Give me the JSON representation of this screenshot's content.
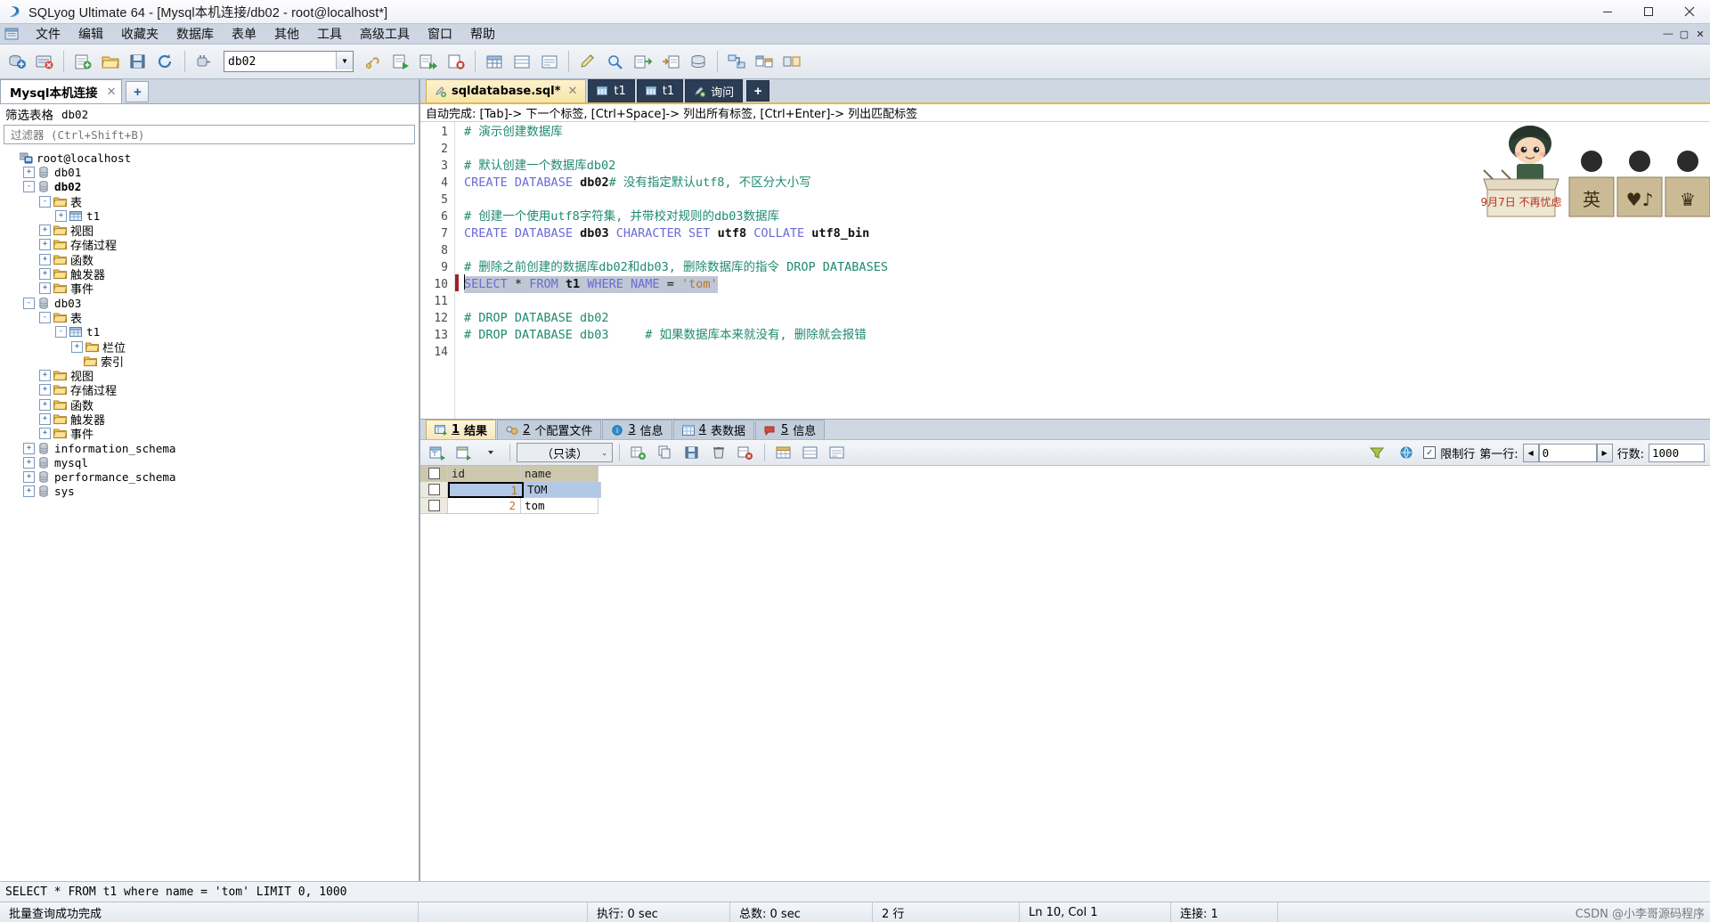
{
  "window": {
    "title": "SQLyog Ultimate 64 - [Mysql本机连接/db02 - root@localhost*]",
    "minimize": "—",
    "maximize": "▢",
    "close": "✕",
    "inner_minimize": "—",
    "inner_restore": "▢",
    "inner_close": "✕"
  },
  "menu": {
    "items": [
      {
        "label": "文件"
      },
      {
        "label": "编辑"
      },
      {
        "label": "收藏夹"
      },
      {
        "label": "数据库"
      },
      {
        "label": "表单"
      },
      {
        "label": "其他"
      },
      {
        "label": "工具"
      },
      {
        "label": "高级工具"
      },
      {
        "label": "窗口"
      },
      {
        "label": "帮助"
      }
    ]
  },
  "toolbar": {
    "db_selected": "db02",
    "buttons": [
      {
        "name": "new-connection-button"
      },
      {
        "name": "open-file-button"
      },
      {
        "name": "save-file-button"
      },
      {
        "name": "refresh-button"
      },
      {
        "name": "execute-query-button"
      },
      {
        "name": "stop-query-button"
      }
    ]
  },
  "sidebar": {
    "connection_tab": "Mysql本机连接",
    "connection_tab_close": "✕",
    "add_connection": "+",
    "filter_label": "筛选表格",
    "filter_db": "db02",
    "filter_placeholder": "过滤器 (Ctrl+Shift+B)",
    "filter_value": "",
    "tree": [
      {
        "label": "root@localhost",
        "level": 0,
        "expander": "",
        "icon": "server-icon",
        "bold": false,
        "cn": false
      },
      {
        "label": "db01",
        "level": 1,
        "expander": "+",
        "icon": "database-icon",
        "bold": false,
        "cn": false
      },
      {
        "label": "db02",
        "level": 1,
        "expander": "-",
        "icon": "database-icon",
        "bold": true,
        "cn": false
      },
      {
        "label": "表",
        "level": 2,
        "expander": "-",
        "icon": "folder-icon",
        "bold": false,
        "cn": true
      },
      {
        "label": "t1",
        "level": 3,
        "expander": "+",
        "icon": "table-icon",
        "bold": false,
        "cn": false
      },
      {
        "label": "视图",
        "level": 2,
        "expander": "+",
        "icon": "folder-icon",
        "bold": false,
        "cn": true
      },
      {
        "label": "存储过程",
        "level": 2,
        "expander": "+",
        "icon": "folder-icon",
        "bold": false,
        "cn": true
      },
      {
        "label": "函数",
        "level": 2,
        "expander": "+",
        "icon": "folder-icon",
        "bold": false,
        "cn": true
      },
      {
        "label": "触发器",
        "level": 2,
        "expander": "+",
        "icon": "folder-icon",
        "bold": false,
        "cn": true
      },
      {
        "label": "事件",
        "level": 2,
        "expander": "+",
        "icon": "folder-icon",
        "bold": false,
        "cn": true
      },
      {
        "label": "db03",
        "level": 1,
        "expander": "-",
        "icon": "database-icon",
        "bold": false,
        "cn": false
      },
      {
        "label": "表",
        "level": 2,
        "expander": "-",
        "icon": "folder-icon",
        "bold": false,
        "cn": true
      },
      {
        "label": "t1",
        "level": 3,
        "expander": "-",
        "icon": "table-icon",
        "bold": false,
        "cn": false
      },
      {
        "label": "栏位",
        "level": 4,
        "expander": "+",
        "icon": "folder-icon",
        "bold": false,
        "cn": true
      },
      {
        "label": "索引",
        "level": 4,
        "expander": "",
        "icon": "folder-icon",
        "bold": false,
        "cn": true
      },
      {
        "label": "视图",
        "level": 2,
        "expander": "+",
        "icon": "folder-icon",
        "bold": false,
        "cn": true
      },
      {
        "label": "存储过程",
        "level": 2,
        "expander": "+",
        "icon": "folder-icon",
        "bold": false,
        "cn": true
      },
      {
        "label": "函数",
        "level": 2,
        "expander": "+",
        "icon": "folder-icon",
        "bold": false,
        "cn": true
      },
      {
        "label": "触发器",
        "level": 2,
        "expander": "+",
        "icon": "folder-icon",
        "bold": false,
        "cn": true
      },
      {
        "label": "事件",
        "level": 2,
        "expander": "+",
        "icon": "folder-icon",
        "bold": false,
        "cn": true
      },
      {
        "label": "information_schema",
        "level": 1,
        "expander": "+",
        "icon": "database-icon",
        "bold": false,
        "cn": false
      },
      {
        "label": "mysql",
        "level": 1,
        "expander": "+",
        "icon": "database-icon",
        "bold": false,
        "cn": false
      },
      {
        "label": "performance_schema",
        "level": 1,
        "expander": "+",
        "icon": "database-icon",
        "bold": false,
        "cn": false
      },
      {
        "label": "sys",
        "level": 1,
        "expander": "+",
        "icon": "database-icon",
        "bold": false,
        "cn": false
      }
    ]
  },
  "editor": {
    "tabs": [
      {
        "label": "sqldatabase.sql*",
        "icon": "query-icon",
        "active": true,
        "closable": true,
        "close": "✕"
      },
      {
        "label": "t1",
        "icon": "table-icon",
        "active": false,
        "closable": false
      },
      {
        "label": "t1",
        "icon": "table-icon",
        "active": false,
        "closable": false
      },
      {
        "label": "询问",
        "icon": "query-icon",
        "active": false,
        "closable": false
      }
    ],
    "add_tab": "+",
    "hint": "自动完成: [Tab]-> 下一个标签, [Ctrl+Space]-> 列出所有标签, [Ctrl+Enter]-> 列出匹配标签",
    "line_numbers": [
      "1",
      "2",
      "3",
      "4",
      "5",
      "6",
      "7",
      "8",
      "9",
      "10",
      "11",
      "12",
      "13",
      "14"
    ],
    "lines": [
      {
        "n": 1,
        "text": "# 演示创建数据库"
      },
      {
        "n": 2,
        "text": ""
      },
      {
        "n": 3,
        "text": "# 默认创建一个数据库db02"
      },
      {
        "n": 4,
        "text": "CREATE DATABASE db02# 没有指定默认utf8, 不区分大小写"
      },
      {
        "n": 5,
        "text": ""
      },
      {
        "n": 6,
        "text": "# 创建一个使用utf8字符集, 并带校对规则的db03数据库"
      },
      {
        "n": 7,
        "text": "CREATE DATABASE db03 CHARACTER SET utf8 COLLATE utf8_bin"
      },
      {
        "n": 8,
        "text": ""
      },
      {
        "n": 9,
        "text": "# 删除之前创建的数据库db02和db03, 删除数据库的指令 DROP DATABASES"
      },
      {
        "n": 10,
        "text": "SELECT * FROM t1 WHERE NAME = 'tom'"
      },
      {
        "n": 11,
        "text": ""
      },
      {
        "n": 12,
        "text": "# DROP DATABASE db02"
      },
      {
        "n": 13,
        "text": "# DROP DATABASE db03     # 如果数据库本来就没有, 删除就会报错"
      },
      {
        "n": 14,
        "text": ""
      }
    ]
  },
  "results": {
    "tabs": [
      {
        "num": "1",
        "label": "结果",
        "active": true,
        "icon": "result-grid-icon"
      },
      {
        "num": "2",
        "label": "个配置文件",
        "active": false,
        "icon": "profile-icon"
      },
      {
        "num": "3",
        "label": "信息",
        "active": false,
        "icon": "info-icon"
      },
      {
        "num": "4",
        "label": "表数据",
        "active": false,
        "icon": "table-data-icon"
      },
      {
        "num": "5",
        "label": "信息",
        "active": false,
        "icon": "message-icon"
      }
    ],
    "mode_select": "（只读）",
    "mode_arrow": "⌄",
    "limit_checkbox_checked": true,
    "limit_label": "限制行",
    "first_row_label": "第一行:",
    "first_row_value": "0",
    "rows_label": "行数:",
    "rows_value": "1000",
    "prev_arrow": "◀",
    "next_arrow": "▶",
    "columns": [
      "id",
      "name"
    ],
    "rows": [
      {
        "id": "1",
        "name": "TOM",
        "selected": true
      },
      {
        "id": "2",
        "name": "tom",
        "selected": false
      }
    ]
  },
  "sql_status": {
    "query": "SELECT * FROM t1 where name = 'tom' LIMIT 0, 1000"
  },
  "statusbar": {
    "message": "批量查询成功完成",
    "exec_time": "执行: 0 sec",
    "total_time": "总数: 0 sec",
    "row_count": "2 行",
    "cursor": "Ln 10, Col 1",
    "connections": "连接: 1",
    "watermark": "CSDN @小李哥源码程序",
    "watermark_blue": "源码程序"
  },
  "colors": {
    "accent_yellow": "#f6e6ba",
    "tab_dark": "#2b3c55",
    "comment_green": "#1f8a70",
    "keyword_blue": "#6a6ad6",
    "string_orange": "#b8742a",
    "selection_gray": "#bfc7d4",
    "grid_header": "#cdc7ae",
    "row_selected": "#b3c7e6"
  }
}
